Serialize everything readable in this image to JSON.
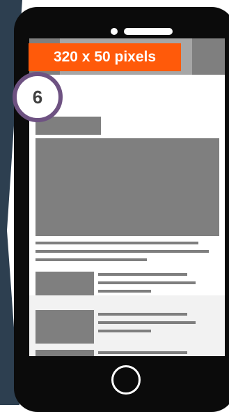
{
  "ad_label": "320 x 50 pixels",
  "step_number": "6",
  "colors": {
    "backdrop": "#2d3f50",
    "phone_body": "#0b0b0b",
    "ad_label_bg": "#ff5a0a",
    "badge_border": "#6e5282",
    "placeholder_dark": "#7f7f7f",
    "placeholder_light": "#a6a6a6"
  }
}
